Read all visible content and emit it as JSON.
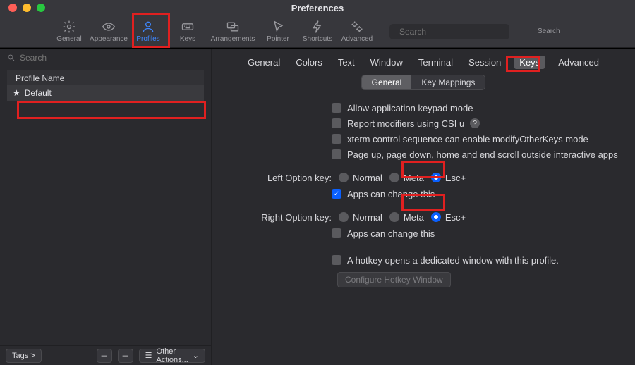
{
  "window": {
    "title": "Preferences"
  },
  "toolbar": {
    "items": [
      {
        "id": "general",
        "label": "General"
      },
      {
        "id": "appearance",
        "label": "Appearance"
      },
      {
        "id": "profiles",
        "label": "Profiles"
      },
      {
        "id": "keys",
        "label": "Keys"
      },
      {
        "id": "arrangements",
        "label": "Arrangements"
      },
      {
        "id": "pointer",
        "label": "Pointer"
      },
      {
        "id": "shortcuts",
        "label": "Shortcuts"
      },
      {
        "id": "advanced",
        "label": "Advanced"
      }
    ],
    "search_placeholder": "Search",
    "search_label": "Search"
  },
  "sidebar": {
    "search_placeholder": "Search",
    "header": "Profile Name",
    "profiles": [
      "Default"
    ],
    "footer": {
      "tags": "Tags >",
      "other_actions": "Other Actions..."
    }
  },
  "content": {
    "tabs": [
      "General",
      "Colors",
      "Text",
      "Window",
      "Terminal",
      "Session",
      "Keys",
      "Advanced"
    ],
    "active_tab": "Keys",
    "subtabs": [
      "General",
      "Key Mappings"
    ],
    "active_subtab": "General",
    "checks": {
      "allow_keypad": "Allow application keypad mode",
      "report_csi": "Report modifiers using CSI u",
      "xterm_modify": "xterm control sequence can enable modifyOtherKeys mode",
      "page_scroll": "Page up, page down, home and end scroll outside interactive apps",
      "apps_change_left": "Apps can change this",
      "apps_change_right": "Apps can change this",
      "hotkey_opens": "A hotkey opens a dedicated window with this profile."
    },
    "left_label": "Left Option key:",
    "right_label": "Right Option key:",
    "radio_opts": [
      "Normal",
      "Meta",
      "Esc+"
    ],
    "configure_btn": "Configure Hotkey Window"
  }
}
